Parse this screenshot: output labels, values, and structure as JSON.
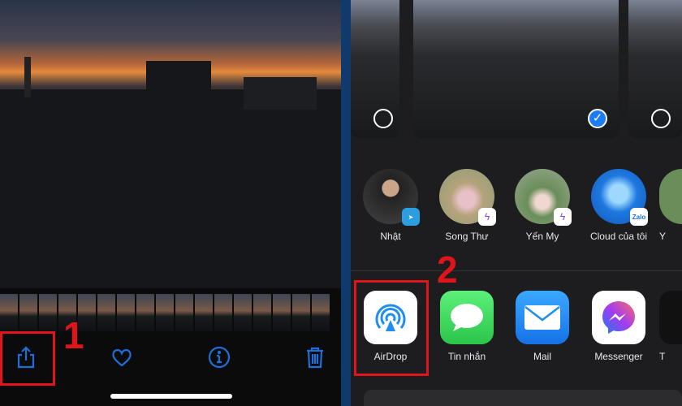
{
  "photos_toolbar": {
    "share": "share-icon",
    "favorite": "heart-icon",
    "info": "info-icon",
    "delete": "trash-icon"
  },
  "share_sheet": {
    "contacts": [
      {
        "name": "Nhật",
        "app_badge": "telegram"
      },
      {
        "name": "Song Thư",
        "app_badge": "messenger"
      },
      {
        "name": "Yến My",
        "app_badge": "messenger"
      },
      {
        "name": "Cloud của tôi",
        "app_badge": "Zalo"
      },
      {
        "name": "Y"
      }
    ],
    "apps": [
      {
        "name": "AirDrop"
      },
      {
        "name": "Tin nhắn"
      },
      {
        "name": "Mail"
      },
      {
        "name": "Messenger"
      },
      {
        "name": "T"
      }
    ]
  },
  "annotations": {
    "step1": "1",
    "step2": "2",
    "highlight_color": "#e0141b"
  },
  "colors": {
    "accent": "#1e6fd9",
    "selected": "#1e7cf2"
  }
}
